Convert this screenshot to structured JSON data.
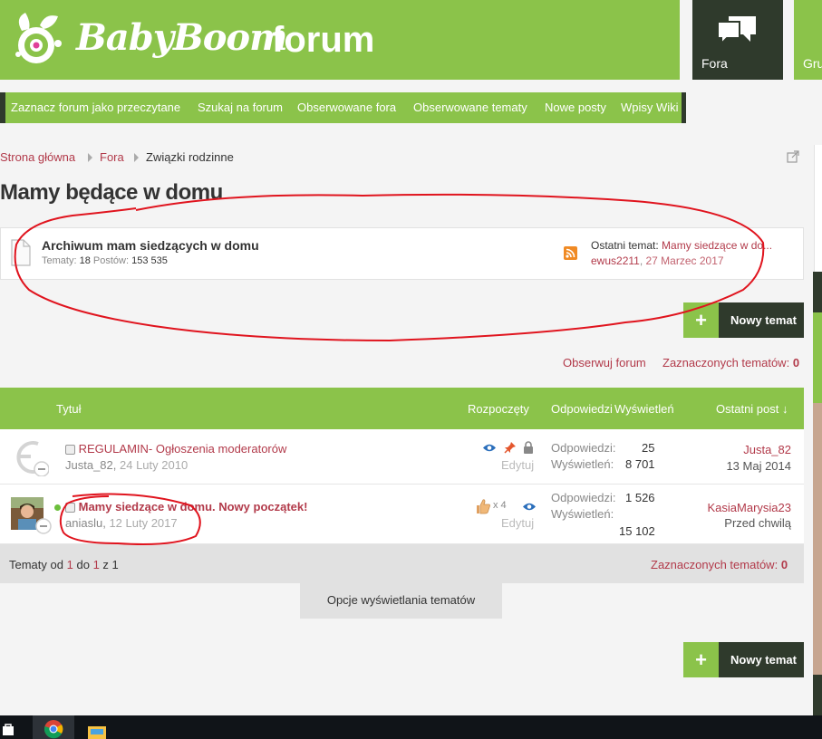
{
  "header": {
    "logo_text": "BabyBoom",
    "logo_suffix": "forum",
    "nav_fora": "Fora",
    "nav_gru": "Gru"
  },
  "subnav": {
    "items": [
      "Zaznacz forum jako przeczytane",
      "Szukaj na forum",
      "Obserwowane fora",
      "Obserwowane tematy",
      "Nowe posty",
      "Wpisy Wiki"
    ]
  },
  "breadcrumb": {
    "home": "Strona główna",
    "fora": "Fora",
    "current": "Związki rodzinne"
  },
  "page_title": "Mamy będące w domu",
  "subforum": {
    "title": "Archiwum mam siedzących w domu",
    "topics_label": "Tematy:",
    "topics_value": "18",
    "posts_label": "Postów:",
    "posts_value": "153 535",
    "last_label": "Ostatni temat:",
    "last_title": "Mamy siedzące w do...",
    "last_user": "ewus2211",
    "last_date": "27 Marzec 2017"
  },
  "buttons": {
    "new_topic": "Nowy temat",
    "plus": "+",
    "watch_forum": "Obserwuj forum",
    "selected_label": "Zaznaczonych tematów:",
    "selected_count": "0",
    "display_options": "Opcje wyświetlania tematów"
  },
  "table": {
    "headers": {
      "title": "Tytuł",
      "started": "Rozpoczęty",
      "replies": "Odpowiedzi",
      "views": "Wyświetleń",
      "last_post": "Ostatni post ↓"
    },
    "rows": [
      {
        "title": "REGULAMIN- Ogłoszenia moderatorów",
        "author": "Justa_82",
        "date": "24 Luty 2010",
        "edit": "Edytuj",
        "replies_label": "Odpowiedzi:",
        "replies": "25",
        "views_label": "Wyświetleń:",
        "views": "8 701",
        "last_user": "Justa_82",
        "last_date": "13 Maj 2014"
      },
      {
        "title": "Mamy siedzące w domu. Nowy początek!",
        "author": "aniaslu",
        "date": "12 Luty 2017",
        "likes": "x 4",
        "edit": "Edytuj",
        "replies_label": "Odpowiedzi:",
        "replies": "1 526",
        "views_label": "Wyświetleń:",
        "views": "15 102",
        "last_user": "KasiaMarysia23",
        "last_date": "Przed chwilą"
      }
    ]
  },
  "pagination": {
    "prefix": "Tematy od",
    "from": "1",
    "mid": "do",
    "to": "1",
    "of_label": "z",
    "total": "1"
  },
  "colors": {
    "brand_green": "#8bc34a",
    "dark": "#2f3a2c",
    "link_red": "#b23a4a",
    "annotation_red": "#e0141e"
  }
}
